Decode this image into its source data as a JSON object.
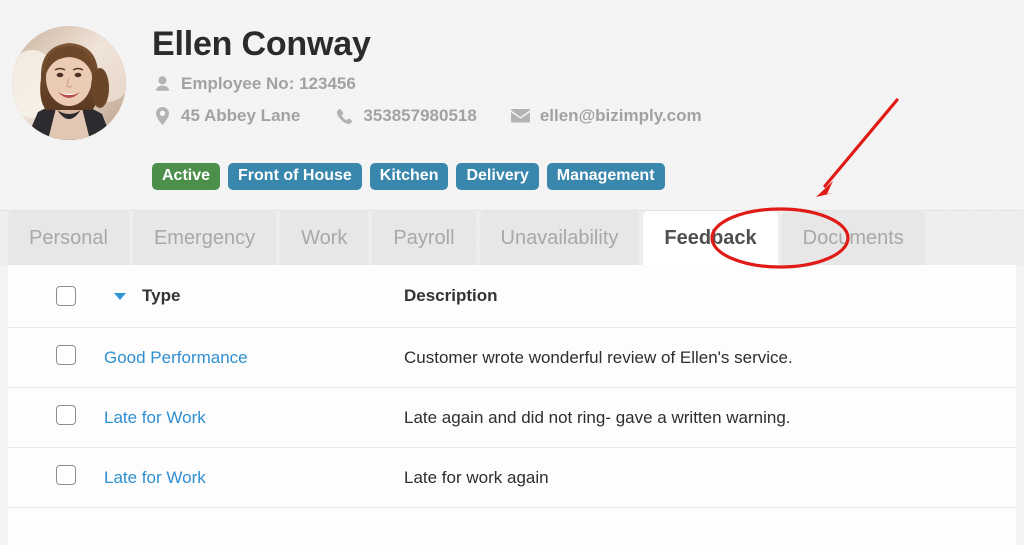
{
  "profile": {
    "name": "Ellen Conway",
    "avatar_alt": "employee-portrait",
    "meta": {
      "employee_no": "Employee No: 123456",
      "address": "45 Abbey Lane",
      "phone": "353857980518",
      "email": "ellen@bizimply.com"
    },
    "badges": [
      {
        "label": "Active",
        "color": "#4b8f4b"
      },
      {
        "label": "Front of House",
        "color": "#3a87ad"
      },
      {
        "label": "Kitchen",
        "color": "#3a87ad"
      },
      {
        "label": "Delivery",
        "color": "#3a87ad"
      },
      {
        "label": "Management",
        "color": "#3a87ad"
      }
    ]
  },
  "tabs": [
    {
      "label": "Personal",
      "active": false
    },
    {
      "label": "Emergency",
      "active": false
    },
    {
      "label": "Work",
      "active": false
    },
    {
      "label": "Payroll",
      "active": false
    },
    {
      "label": "Unavailability",
      "active": false
    },
    {
      "label": "Feedback",
      "active": true
    },
    {
      "label": "Documents",
      "active": false
    }
  ],
  "table": {
    "columns": {
      "type": "Type",
      "description": "Description"
    },
    "rows": [
      {
        "type": "Good Performance",
        "description": "Customer wrote wonderful review of Ellen's service."
      },
      {
        "type": "Late for Work",
        "description": "Late again and did not ring- gave a written warning."
      },
      {
        "type": "Late for Work",
        "description": "Late for work again"
      }
    ]
  },
  "annotations": {
    "arrow_color": "#e01b16",
    "ellipse_color": "#e01b16",
    "highlights_tab": "Feedback"
  },
  "colors": {
    "link": "#2f8fd0",
    "sort_caret": "#2f93d6",
    "page_background": "#f4f4f4",
    "panel_background": "#fdfdfd",
    "tabbar_background": "#eeeeee"
  }
}
